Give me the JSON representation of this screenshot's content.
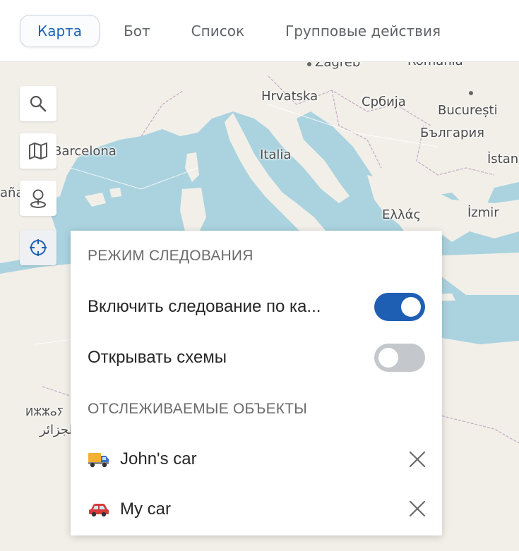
{
  "tabs": [
    {
      "label": "Карта",
      "active": true
    },
    {
      "label": "Бот",
      "active": false
    },
    {
      "label": "Список",
      "active": false
    },
    {
      "label": "Групповые действия",
      "active": false
    }
  ],
  "map": {
    "labels": {
      "zagreb": "Zagreb",
      "romania": "România",
      "hrvatska": "Hrvatska",
      "srbija": "Србија",
      "bucuresti": "București",
      "bulgaria": "България",
      "barcelona": "Barcelona",
      "italia": "Italia",
      "istanbul": "İstan",
      "espana": "aña",
      "ellas": "Ελλάς",
      "izmir": "İzmir",
      "algeria_tz": "ⵍⵣⵣⴰⵢ",
      "algeria_ar": "الجزائر"
    },
    "controls": [
      "search-icon",
      "map-icon",
      "location-pin-icon",
      "crosshair-icon"
    ]
  },
  "follow_panel": {
    "mode_title": "РЕЖИМ СЛЕДОВАНИЯ",
    "follow_on_map_label": "Включить следование по ка...",
    "follow_on_map_enabled": true,
    "open_schemes_label": "Открывать схемы",
    "open_schemes_enabled": false,
    "tracked_title": "ОТСЛЕЖИВАЕМЫЕ ОБЪЕКТЫ",
    "objects": [
      {
        "name": "John's car",
        "icon": "truck-icon"
      },
      {
        "name": "My car",
        "icon": "car-icon"
      }
    ]
  },
  "colors": {
    "accent": "#1f5fb3",
    "active_tab_text": "#1a63b8",
    "water": "#aad3df",
    "land": "#f2efe9",
    "toggle_off": "#c4c7cc"
  }
}
